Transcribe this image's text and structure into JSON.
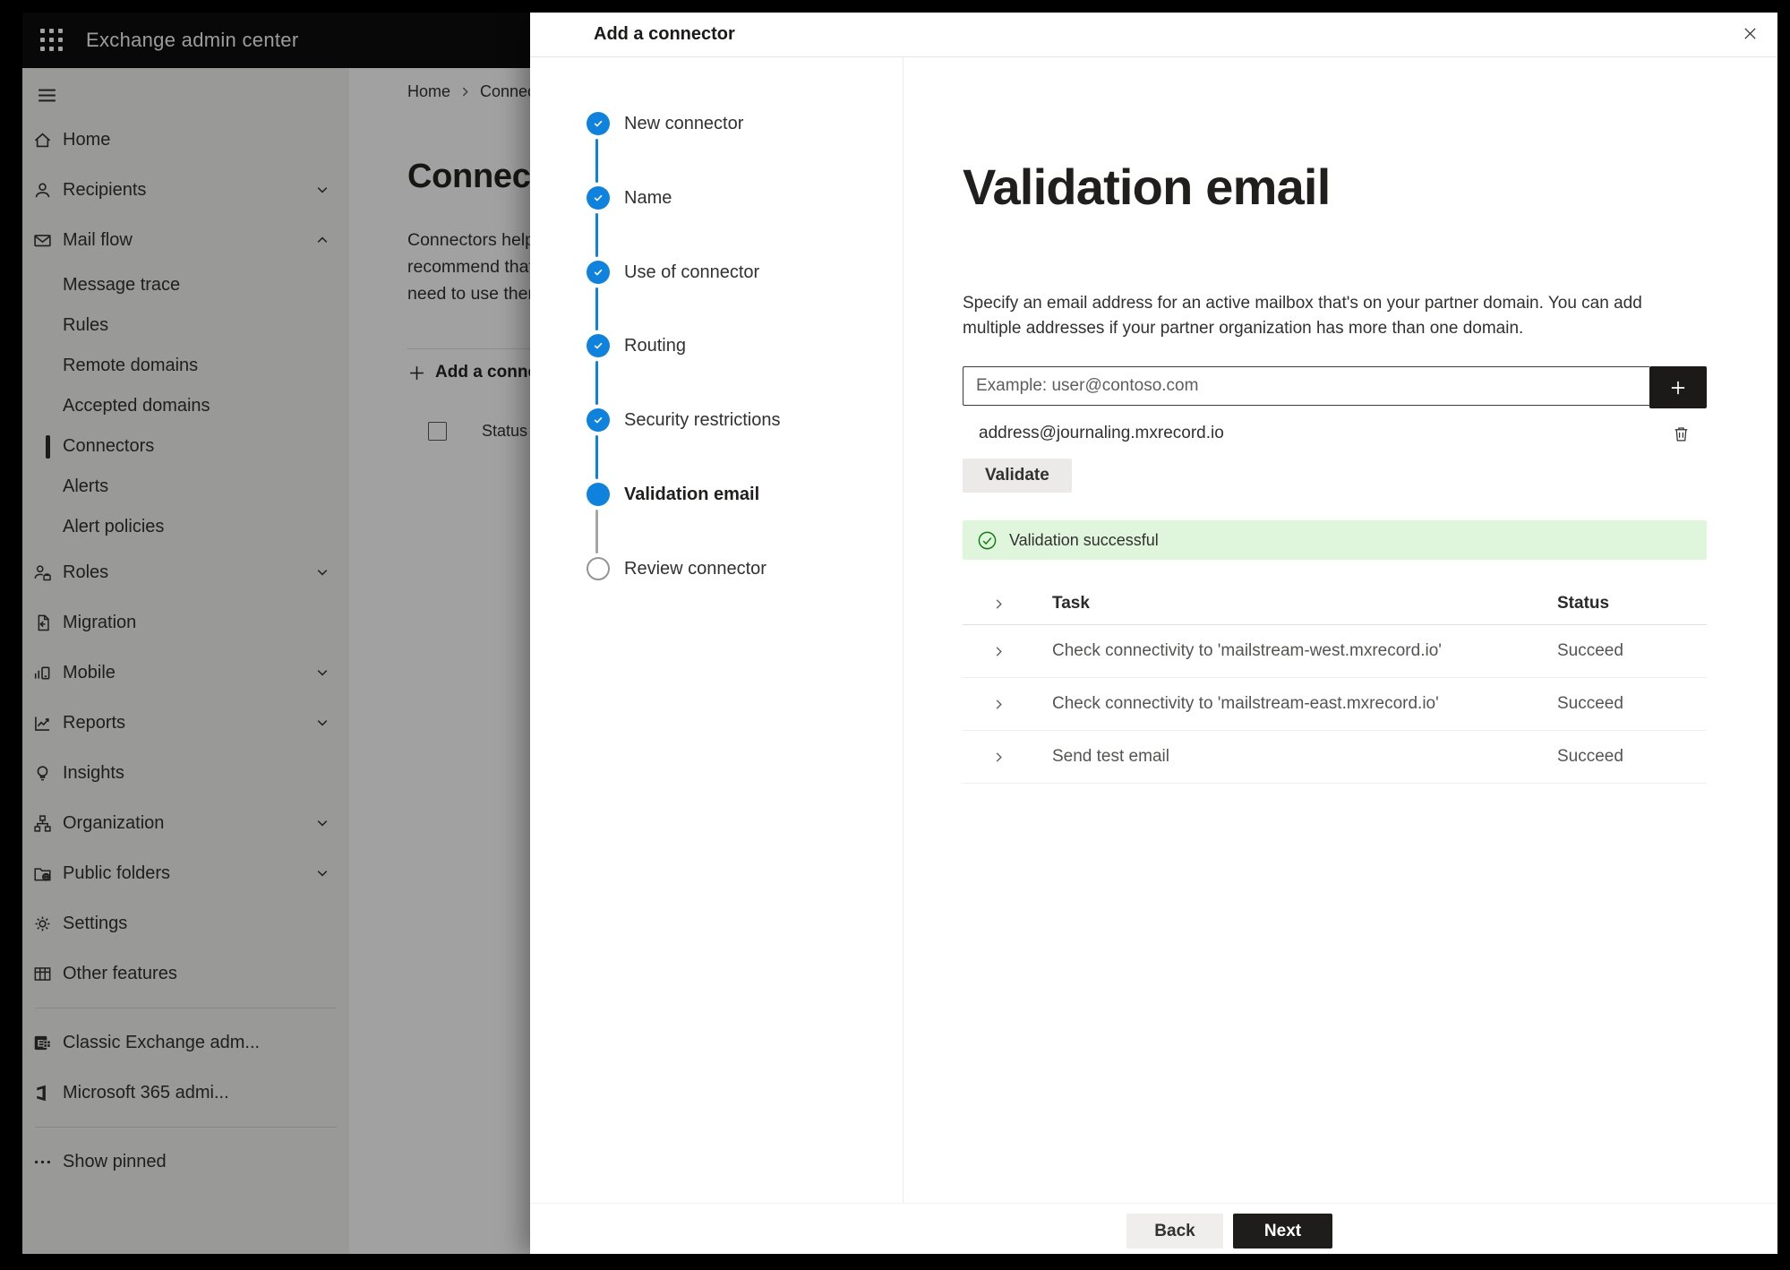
{
  "colors": {
    "accent_blue": "#0f82dd",
    "success_green": "#107c10",
    "banner_bg": "#dff6dd",
    "topbar_bg": "#0d0d0d",
    "sidebar_bg": "#f3f2f1",
    "nav_selected_indicator": "#2b2b2b",
    "primary_button_bg": "#1e1d1c"
  },
  "app": {
    "title": "Exchange admin center"
  },
  "sidebar": {
    "items": [
      {
        "label": "Home",
        "icon": "home"
      },
      {
        "label": "Recipients",
        "icon": "person",
        "chevron": "down"
      },
      {
        "label": "Mail flow",
        "icon": "mail",
        "chevron": "up"
      },
      {
        "label": "Message trace",
        "type": "sub"
      },
      {
        "label": "Rules",
        "type": "sub"
      },
      {
        "label": "Remote domains",
        "type": "sub"
      },
      {
        "label": "Accepted domains",
        "type": "sub"
      },
      {
        "label": "Connectors",
        "type": "sub",
        "selected": true
      },
      {
        "label": "Alerts",
        "type": "sub"
      },
      {
        "label": "Alert policies",
        "type": "sub"
      },
      {
        "label": "Roles",
        "icon": "person-briefcase",
        "chevron": "down"
      },
      {
        "label": "Migration",
        "icon": "page-arrow"
      },
      {
        "label": "Mobile",
        "icon": "mobile-chart",
        "chevron": "down"
      },
      {
        "label": "Reports",
        "icon": "line-chart",
        "chevron": "down"
      },
      {
        "label": "Insights",
        "icon": "lightbulb"
      },
      {
        "label": "Organization",
        "icon": "org-chart",
        "chevron": "down"
      },
      {
        "label": "Public folders",
        "icon": "folder-globe",
        "chevron": "down"
      },
      {
        "label": "Settings",
        "icon": "gear"
      },
      {
        "label": "Other features",
        "icon": "table-grid"
      },
      {
        "divider": true
      },
      {
        "label": "Classic Exchange adm...",
        "icon": "exchange-logo"
      },
      {
        "label": "Microsoft 365 admi...",
        "icon": "office-logo"
      },
      {
        "divider": true
      },
      {
        "label": "Show pinned",
        "icon": "ellipsis"
      }
    ]
  },
  "page": {
    "breadcrumb": {
      "home": "Home",
      "current": "Connectors"
    },
    "title": "Connectors",
    "intro_lines": {
      "0": "Connectors help",
      "1": "recommend that",
      "2": "need to use them"
    },
    "add_button": "Add a connector",
    "column_status": "Status"
  },
  "wizard": {
    "title": "Add a connector",
    "steps": [
      {
        "label": "New connector",
        "state": "done"
      },
      {
        "label": "Name",
        "state": "done"
      },
      {
        "label": "Use of connector",
        "state": "done"
      },
      {
        "label": "Routing",
        "state": "done"
      },
      {
        "label": "Security restrictions",
        "state": "done"
      },
      {
        "label": "Validation email",
        "state": "current"
      },
      {
        "label": "Review connector",
        "state": "todo"
      }
    ]
  },
  "panel": {
    "heading": "Validation email",
    "description_lines": {
      "0": "Specify an email address for an active mailbox that's on your partner domain. You can add",
      "1": "multiple addresses if your partner organization has more than one domain."
    },
    "email_placeholder": "Example: user@contoso.com",
    "address": "address@journaling.mxrecord.io",
    "validate_button": "Validate",
    "banner_text": "Validation successful",
    "table": {
      "col_task": "Task",
      "col_status": "Status",
      "rows": [
        {
          "task": "Check connectivity to 'mailstream-west.mxrecord.io'",
          "status": "Succeed"
        },
        {
          "task": "Check connectivity to 'mailstream-east.mxrecord.io'",
          "status": "Succeed"
        },
        {
          "task": "Send test email",
          "status": "Succeed"
        }
      ]
    },
    "back_button": "Back",
    "next_button": "Next"
  }
}
